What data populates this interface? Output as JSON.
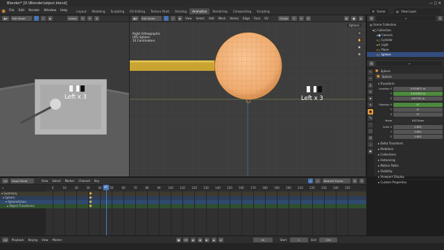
{
  "window": {
    "title": "Blender* [D:\\Blender\\object.blend]"
  },
  "menu": [
    "File",
    "Edit",
    "Render",
    "Window",
    "Help"
  ],
  "workspaces": [
    "Layout",
    "Modeling",
    "Sculpting",
    "UV Editing",
    "Texture Paint",
    "Shading",
    "Animation",
    "Rendering",
    "Compositing",
    "Scripting"
  ],
  "active_workspace": "Animation",
  "scene": {
    "name": "Scene",
    "view_layer": "View Layer"
  },
  "left_viewport": {
    "header": {
      "mode": "Edit Mode",
      "orientation": "Global"
    },
    "label": "Left x 3"
  },
  "main_viewport": {
    "header": {
      "mode": "Edit Mode",
      "menus": [
        "View",
        "Select",
        "Add",
        "Mesh",
        "Vertex",
        "Edge",
        "Face",
        "UV"
      ],
      "orientation": "Global",
      "options": "Options"
    },
    "info": [
      "Right Orthographic",
      "(45) Sphere",
      "10 Centimeters"
    ],
    "label": "Left x 3"
  },
  "outliner": {
    "title": "Scene Collection",
    "items": [
      "Collection",
      "Camera",
      "Cylinder",
      "Light",
      "Plane",
      "Sphere"
    ]
  },
  "properties": {
    "object_name": "Sphere",
    "data_name": "Sphere",
    "transform_title": "Transform",
    "location_label": "Location X",
    "location": [
      "0.554871 m",
      "0.000000 m",
      "0.87132 m"
    ],
    "rotation_label": "Rotation X",
    "rotation": [
      "0°",
      "0°",
      "0°"
    ],
    "mode_label": "Mode",
    "mode": "XYZ Euler",
    "scale_label": "Scale X",
    "scale": [
      "0.852",
      "0.852",
      "0.852"
    ],
    "sections": [
      "Delta Transform",
      "Relations",
      "Collections",
      "Instancing",
      "Motion Paths",
      "Visibility",
      "Viewport Display",
      "Custom Properties"
    ]
  },
  "dopesheet": {
    "mode": "Dope Sheet",
    "menus": [
      "View",
      "Select",
      "Marker",
      "Channel",
      "Key"
    ],
    "filter": "Nearest Frame",
    "frames": [
      "0",
      "10",
      "20",
      "30",
      "40",
      "50",
      "60",
      "70",
      "80",
      "90",
      "100",
      "110",
      "120",
      "130",
      "140",
      "150",
      "160",
      "170",
      "180",
      "190",
      "200",
      "210",
      "220",
      "230",
      "240",
      "250"
    ],
    "current_frame": "45",
    "channels": [
      "Summary",
      "Sphere",
      "SphereAction",
      "Object Transforms"
    ]
  },
  "playback": {
    "menus": [
      "Playback",
      "Keying",
      "View",
      "Marker"
    ],
    "current": "45",
    "start_label": "Start",
    "start": "1",
    "end_label": "End",
    "end": "250"
  },
  "colors": {
    "accent": "#4772b3",
    "orange": "#e59b3a",
    "sphere": "#f0b07a",
    "cylinder": "#c9a430"
  }
}
